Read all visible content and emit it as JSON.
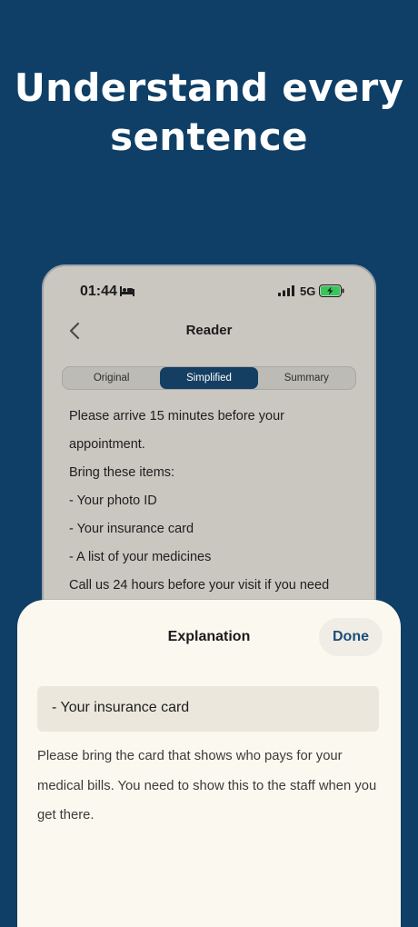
{
  "headline": {
    "line1": "Understand every",
    "line2": "sentence"
  },
  "status_bar": {
    "time": "01:44",
    "network": "5G",
    "icons": [
      "bed-icon",
      "signal-icon",
      "battery-charging-icon"
    ]
  },
  "nav": {
    "title": "Reader",
    "back_icon": "chevron-left-icon"
  },
  "segments": {
    "items": [
      "Original",
      "Simplified",
      "Summary"
    ],
    "selected": "Simplified"
  },
  "document": {
    "lines": [
      "Please arrive 15 minutes before your",
      "appointment.",
      "Bring these items:",
      "- Your photo ID",
      "- Your insurance card",
      "- A list of your medicines",
      "Call us 24 hours before your visit if you need"
    ]
  },
  "sheet": {
    "title": "Explanation",
    "done_label": "Done",
    "selected_text": "- Your insurance card",
    "explanation": "Please bring the card that shows who pays for your medical bills. You need to show this to the staff when you get there."
  },
  "colors": {
    "background": "#0f3f66",
    "accent": "#143f63",
    "sheet": "#fbf8ef",
    "battery": "#34c759"
  }
}
